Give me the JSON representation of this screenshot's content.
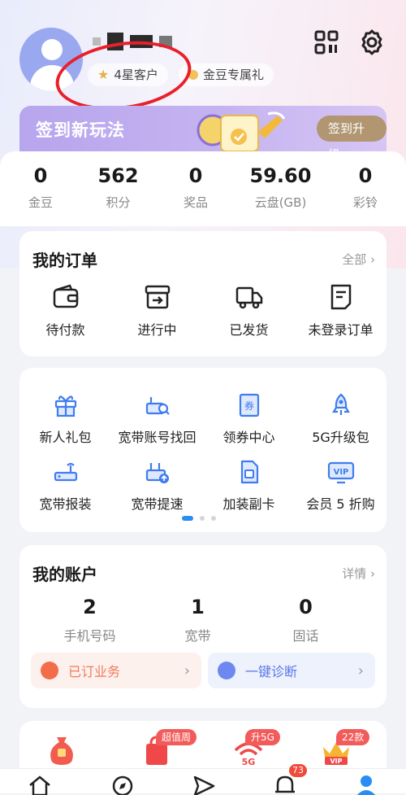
{
  "header": {
    "badges": [
      {
        "label": "4星客户",
        "icon": "star-icon"
      },
      {
        "label": "金豆专属礼",
        "icon": "bean-icon"
      }
    ]
  },
  "banner": {
    "title": "签到新玩法",
    "button": "签到升级"
  },
  "stats": [
    {
      "value": "0",
      "label": "金豆"
    },
    {
      "value": "562",
      "label": "积分"
    },
    {
      "value": "0",
      "label": "奖品"
    },
    {
      "value": "59.60",
      "label": "云盘(GB)"
    },
    {
      "value": "0",
      "label": "彩铃"
    }
  ],
  "orders": {
    "title": "我的订单",
    "more": "全部",
    "items": [
      {
        "label": "待付款",
        "icon": "wallet-icon"
      },
      {
        "label": "进行中",
        "icon": "box-icon"
      },
      {
        "label": "已发货",
        "icon": "truck-icon"
      },
      {
        "label": "未登录订单",
        "icon": "document-icon"
      }
    ]
  },
  "services": {
    "row1": [
      {
        "label": "新人礼包",
        "icon": "gift-icon"
      },
      {
        "label": "宽带账号找回",
        "icon": "broadband-search-icon"
      },
      {
        "label": "领券中心",
        "icon": "coupon-icon"
      },
      {
        "label": "5G升级包",
        "icon": "rocket-icon"
      }
    ],
    "row2": [
      {
        "label": "宽带报装",
        "icon": "router-icon"
      },
      {
        "label": "宽带提速",
        "icon": "router-upload-icon"
      },
      {
        "label": "加装副卡",
        "icon": "sim-card-icon"
      },
      {
        "label": "会员 5 折购",
        "icon": "vip-icon"
      }
    ],
    "pages": 3,
    "active_page": 1
  },
  "account": {
    "title": "我的账户",
    "more": "详情",
    "items": [
      {
        "value": "2",
        "label": "手机号码"
      },
      {
        "value": "1",
        "label": "宽带"
      },
      {
        "value": "0",
        "label": "固话"
      }
    ],
    "subscribed": "已订业务",
    "diagnose": "一键诊断"
  },
  "promo": {
    "tags": [
      "超值周",
      "升5G",
      "22款"
    ]
  },
  "tabbar": {
    "badge": "73",
    "active_tab": "profile"
  },
  "colors": {
    "accent_blue": "#2a8df5",
    "gold_button": "#b19671",
    "badge_red": "#f04a3a",
    "annotation_red": "#e8202a"
  }
}
